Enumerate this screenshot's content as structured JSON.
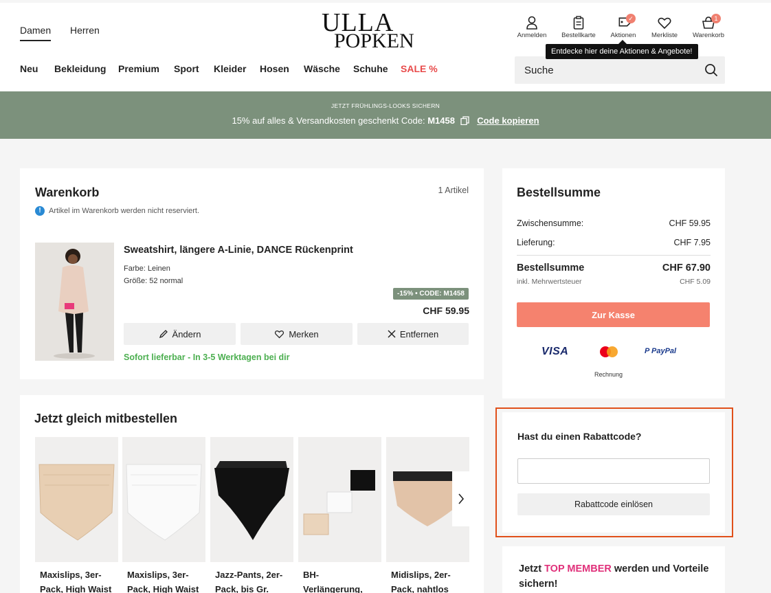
{
  "header": {
    "gender_tabs": [
      "Damen",
      "Herren"
    ],
    "logo": {
      "line1": "ULLA",
      "line2": "POPKEN"
    },
    "icons": [
      {
        "label": "Anmelden",
        "icon": "user-icon"
      },
      {
        "label": "Bestellkarte",
        "icon": "order-card-icon"
      },
      {
        "label": "Aktionen",
        "icon": "tag-icon"
      },
      {
        "label": "Merkliste",
        "icon": "heart-icon"
      },
      {
        "label": "Warenkorb",
        "icon": "basket-icon",
        "badge": "1"
      }
    ],
    "tooltip": "Entdecke hier deine Aktionen & Angebote!",
    "nav": [
      "Neu",
      "Bekleidung",
      "Premium",
      "Sport",
      "Kleider",
      "Hosen",
      "Wäsche",
      "Schuhe",
      "SALE %"
    ],
    "search_placeholder": "Suche"
  },
  "promo": {
    "small": "JETZT FRÜHLINGS-LOOKS SICHERN",
    "text": "15% auf alles & Versandkosten geschenkt Code:",
    "code": "M1458",
    "copy_label": "Code kopieren"
  },
  "cart": {
    "title": "Warenkorb",
    "count": "1 Artikel",
    "notice": "Artikel im Warenkorb werden nicht reserviert.",
    "item": {
      "name": "Sweatshirt, längere A-Linie, DANCE Rückenprint",
      "color": "Farbe: Leinen",
      "size": "Größe: 52 normal",
      "discount_badge": "-15% • CODE: M1458",
      "price": "CHF 59.95",
      "availability": "Sofort lieferbar - In 3-5 Werktagen bei dir"
    },
    "buttons": {
      "edit": "Ändern",
      "save": "Merken",
      "remove": "Entfernen"
    }
  },
  "recommendations": {
    "title": "Jetzt gleich mitbestellen",
    "items": [
      {
        "name_l1": "Maxislips, 3er-",
        "name_l2": "Pack, High Waist"
      },
      {
        "name_l1": "Maxislips, 3er-",
        "name_l2": "Pack, High Waist"
      },
      {
        "name_l1": "Jazz-Pants, 2er-",
        "name_l2": "Pack, bis Gr."
      },
      {
        "name_l1": "BH-",
        "name_l2": "Verlängerung,"
      },
      {
        "name_l1": "Midislips, 2er-",
        "name_l2": "Pack, nahtlos"
      }
    ]
  },
  "summary": {
    "title": "Bestellsumme",
    "subtotal_label": "Zwischensumme:",
    "subtotal": "CHF 59.95",
    "shipping_label": "Lieferung:",
    "shipping": "CHF 7.95",
    "total_label": "Bestellsumme",
    "total": "CHF 67.90",
    "vat_label": "inkl. Mehrwertsteuer",
    "vat": "CHF 5.09",
    "checkout": "Zur Kasse",
    "payments": {
      "visa": "VISA",
      "paypal": "PayPal",
      "invoice": "Rechnung"
    }
  },
  "coupon": {
    "title": "Hast du einen Rabattcode?",
    "button": "Rabattcode einlösen"
  },
  "member": {
    "pre": "Jetzt",
    "highlight": "TOP MEMBER",
    "post": "werden und Vorteile",
    "line2": "sichern!"
  },
  "colors": {
    "accent": "#f5826e",
    "promo_bg": "#7c917c",
    "sale": "#e84a4a",
    "available": "#4caf50",
    "badge_bg": "#7c917c",
    "member": "#e0307a",
    "coupon_border": "#e0501a"
  }
}
